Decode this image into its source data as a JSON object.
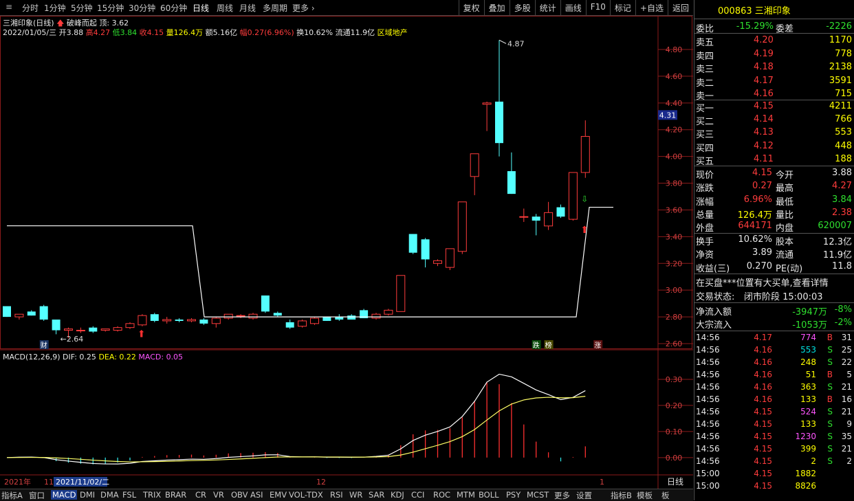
{
  "toolbar": {
    "left_items": [
      "分时",
      "1分钟",
      "5分钟",
      "15分钟",
      "30分钟",
      "60分钟",
      "日线",
      "周线",
      "月线",
      "多周期",
      "更多"
    ],
    "active": "日线",
    "right_items": [
      "复权",
      "叠加",
      "多股",
      "统计",
      "画线",
      "F10",
      "标记",
      "+自选",
      "返回"
    ]
  },
  "chart_header": {
    "title": "三湘印象(日线)",
    "indicator_name": "破峰而起",
    "indicator_value": "顶: 3.62",
    "date_line": "2022/01/05/三",
    "open": "开3.88",
    "high": "高4.27",
    "low": "低3.84",
    "close": "收4.15",
    "volume": "量126.4万",
    "amount": "额5.16亿",
    "change": "幅0.27(6.96%)",
    "turnover": "换10.62%",
    "float": "流通11.9亿",
    "sector": "区域地产"
  },
  "price_axis": [
    "4.80",
    "4.60",
    "4.40",
    "4.20",
    "4.00",
    "3.80",
    "3.60",
    "3.40",
    "3.20",
    "3.00",
    "2.80",
    "2.60"
  ],
  "current_price_tag": "4.31",
  "annotations": {
    "high": "4.87",
    "low": "2.64"
  },
  "markers": {
    "cai": "财",
    "die": "跌",
    "bang": "榜",
    "zhang": "涨"
  },
  "macd_header": {
    "name": "MACD(12,26,9)",
    "dif": "DIF: 0.25",
    "dea": "DEA: 0.22",
    "macd": "MACD: 0.05"
  },
  "macd_axis": [
    "0.30",
    "0.20",
    "0.10",
    "0.00"
  ],
  "time_axis": {
    "year": "2021年",
    "m11": "11",
    "selected_date": "2021/11/02/二",
    "m12": "12",
    "m1": "1"
  },
  "period_label": "日线",
  "chart_data": {
    "type": "candlestick",
    "title": "三湘印象(日线)",
    "price_range": [
      2.55,
      4.95
    ],
    "candles": [
      {
        "o": 2.88,
        "h": 2.88,
        "l": 2.8,
        "c": 2.8
      },
      {
        "o": 2.8,
        "h": 2.82,
        "l": 2.78,
        "c": 2.82
      },
      {
        "o": 2.84,
        "h": 2.85,
        "l": 2.81,
        "c": 2.81
      },
      {
        "o": 2.88,
        "h": 2.89,
        "l": 2.77,
        "c": 2.78
      },
      {
        "o": 2.78,
        "h": 2.78,
        "l": 2.67,
        "c": 2.7
      },
      {
        "o": 2.7,
        "h": 2.72,
        "l": 2.64,
        "c": 2.71
      },
      {
        "o": 2.7,
        "h": 2.72,
        "l": 2.68,
        "c": 2.7
      },
      {
        "o": 2.72,
        "h": 2.73,
        "l": 2.68,
        "c": 2.69
      },
      {
        "o": 2.7,
        "h": 2.71,
        "l": 2.69,
        "c": 2.71
      },
      {
        "o": 2.7,
        "h": 2.73,
        "l": 2.69,
        "c": 2.72
      },
      {
        "o": 2.72,
        "h": 2.76,
        "l": 2.71,
        "c": 2.75
      },
      {
        "o": 2.74,
        "h": 2.82,
        "l": 2.73,
        "c": 2.81
      },
      {
        "o": 2.82,
        "h": 2.83,
        "l": 2.76,
        "c": 2.77
      },
      {
        "o": 2.77,
        "h": 2.8,
        "l": 2.75,
        "c": 2.78
      },
      {
        "o": 2.78,
        "h": 2.79,
        "l": 2.76,
        "c": 2.77
      },
      {
        "o": 2.77,
        "h": 2.79,
        "l": 2.76,
        "c": 2.78
      },
      {
        "o": 2.78,
        "h": 2.79,
        "l": 2.74,
        "c": 2.75
      },
      {
        "o": 2.75,
        "h": 2.8,
        "l": 2.72,
        "c": 2.79
      },
      {
        "o": 2.79,
        "h": 2.82,
        "l": 2.78,
        "c": 2.82
      },
      {
        "o": 2.81,
        "h": 2.82,
        "l": 2.79,
        "c": 2.81
      },
      {
        "o": 2.79,
        "h": 2.83,
        "l": 2.78,
        "c": 2.82
      },
      {
        "o": 2.96,
        "h": 2.96,
        "l": 2.83,
        "c": 2.84
      },
      {
        "o": 2.83,
        "h": 2.84,
        "l": 2.8,
        "c": 2.81
      },
      {
        "o": 2.76,
        "h": 2.78,
        "l": 2.71,
        "c": 2.72
      },
      {
        "o": 2.73,
        "h": 2.78,
        "l": 2.72,
        "c": 2.77
      },
      {
        "o": 2.75,
        "h": 2.8,
        "l": 2.74,
        "c": 2.79
      },
      {
        "o": 2.8,
        "h": 2.8,
        "l": 2.77,
        "c": 2.77
      },
      {
        "o": 2.8,
        "h": 2.82,
        "l": 2.77,
        "c": 2.78
      },
      {
        "o": 2.81,
        "h": 2.82,
        "l": 2.78,
        "c": 2.78
      },
      {
        "o": 2.85,
        "h": 2.86,
        "l": 2.79,
        "c": 2.79
      },
      {
        "o": 2.79,
        "h": 2.83,
        "l": 2.78,
        "c": 2.82
      },
      {
        "o": 2.82,
        "h": 2.86,
        "l": 2.81,
        "c": 2.85
      },
      {
        "o": 2.84,
        "h": 3.11,
        "l": 2.84,
        "c": 3.11
      },
      {
        "o": 3.42,
        "h": 3.42,
        "l": 3.27,
        "c": 3.28
      },
      {
        "o": 3.38,
        "h": 3.39,
        "l": 3.17,
        "c": 3.23
      },
      {
        "o": 3.2,
        "h": 3.23,
        "l": 3.18,
        "c": 3.22
      },
      {
        "o": 3.17,
        "h": 3.31,
        "l": 3.15,
        "c": 3.31
      },
      {
        "o": 3.29,
        "h": 3.66,
        "l": 3.27,
        "c": 3.66
      },
      {
        "o": 3.85,
        "h": 4.02,
        "l": 3.71,
        "c": 4.02
      },
      {
        "o": 4.39,
        "h": 4.41,
        "l": 4.19,
        "c": 4.4
      },
      {
        "o": 4.41,
        "h": 4.87,
        "l": 4.0,
        "c": 4.1
      },
      {
        "o": 3.89,
        "h": 4.03,
        "l": 3.72,
        "c": 3.72
      },
      {
        "o": 3.55,
        "h": 3.61,
        "l": 3.51,
        "c": 3.55
      },
      {
        "o": 3.55,
        "h": 3.57,
        "l": 3.41,
        "c": 3.52
      },
      {
        "o": 3.48,
        "h": 3.66,
        "l": 3.45,
        "c": 3.58
      },
      {
        "o": 3.62,
        "h": 3.64,
        "l": 3.54,
        "c": 3.55
      },
      {
        "o": 3.53,
        "h": 3.88,
        "l": 3.52,
        "c": 3.88
      },
      {
        "o": 3.88,
        "h": 4.27,
        "l": 3.84,
        "c": 4.15
      }
    ],
    "indicator_line": {
      "name": "破峰而起",
      "top_value": 3.62
    },
    "macd": {
      "dif": 0.25,
      "dea": 0.22,
      "macd": 0.05,
      "range": [
        -0.04,
        0.35
      ]
    }
  },
  "panel": {
    "code": "000863",
    "name": "三湘印象",
    "weibi_label": "委比",
    "weibi": "-15.29%",
    "weicha_label": "委差",
    "weicha": "-2226",
    "asks": [
      {
        "label": "卖五",
        "price": "4.20",
        "vol": "1170"
      },
      {
        "label": "卖四",
        "price": "4.19",
        "vol": "778"
      },
      {
        "label": "卖三",
        "price": "4.18",
        "vol": "2138"
      },
      {
        "label": "卖二",
        "price": "4.17",
        "vol": "3591"
      },
      {
        "label": "卖一",
        "price": "4.16",
        "vol": "715"
      }
    ],
    "bids": [
      {
        "label": "买一",
        "price": "4.15",
        "vol": "4211"
      },
      {
        "label": "买二",
        "price": "4.14",
        "vol": "766"
      },
      {
        "label": "买三",
        "price": "4.13",
        "vol": "553"
      },
      {
        "label": "买四",
        "price": "4.12",
        "vol": "448"
      },
      {
        "label": "买五",
        "price": "4.11",
        "vol": "188"
      }
    ],
    "stats": [
      {
        "l1": "现价",
        "v1": "4.15",
        "c1": "red",
        "l2": "今开",
        "v2": "3.88",
        "c2": "white"
      },
      {
        "l1": "涨跌",
        "v1": "0.27",
        "c1": "red",
        "l2": "最高",
        "v2": "4.27",
        "c2": "red"
      },
      {
        "l1": "涨幅",
        "v1": "6.96%",
        "c1": "red",
        "l2": "最低",
        "v2": "3.84",
        "c2": "green"
      },
      {
        "l1": "总量",
        "v1": "126.4万",
        "c1": "yellow",
        "l2": "量比",
        "v2": "2.38",
        "c2": "red"
      },
      {
        "l1": "外盘",
        "v1": "644171",
        "c1": "red",
        "l2": "内盘",
        "v2": "620007",
        "c2": "green"
      }
    ],
    "stats2": [
      {
        "l1": "换手",
        "v1": "10.62%",
        "l2": "股本",
        "v2": "12.3亿"
      },
      {
        "l1": "净资",
        "v1": "3.89",
        "l2": "流通",
        "v2": "11.9亿"
      },
      {
        "l1": "收益(三)",
        "v1": "0.270",
        "l2": "PE(动)",
        "v2": "11.8"
      }
    ],
    "notice": "在买盘***位置有大买单,查看详情",
    "trade_status_label": "交易状态:",
    "trade_status": "闭市阶段 15:00:03",
    "net_inflow_label": "净流入额",
    "net_inflow": "-3947万",
    "net_inflow_pct": "-8%",
    "block_inflow_label": "大宗流入",
    "block_inflow": "-1053万",
    "block_inflow_pct": "-2%",
    "ticks": [
      {
        "t": "14:56",
        "p": "4.17",
        "v": "774",
        "s": "B",
        "n": "31",
        "pc": "red",
        "vc": "magenta"
      },
      {
        "t": "14:56",
        "p": "4.16",
        "v": "553",
        "s": "S",
        "n": "25",
        "pc": "red",
        "vc": "cyan"
      },
      {
        "t": "14:56",
        "p": "4.16",
        "v": "248",
        "s": "S",
        "n": "22",
        "pc": "red",
        "vc": "yellow"
      },
      {
        "t": "14:56",
        "p": "4.16",
        "v": "51",
        "s": "B",
        "n": "5",
        "pc": "red",
        "vc": "yellow"
      },
      {
        "t": "14:56",
        "p": "4.16",
        "v": "363",
        "s": "S",
        "n": "21",
        "pc": "red",
        "vc": "yellow"
      },
      {
        "t": "14:56",
        "p": "4.16",
        "v": "133",
        "s": "B",
        "n": "16",
        "pc": "red",
        "vc": "yellow"
      },
      {
        "t": "14:56",
        "p": "4.15",
        "v": "524",
        "s": "S",
        "n": "21",
        "pc": "red",
        "vc": "magenta"
      },
      {
        "t": "14:56",
        "p": "4.15",
        "v": "133",
        "s": "S",
        "n": "9",
        "pc": "red",
        "vc": "yellow"
      },
      {
        "t": "14:56",
        "p": "4.15",
        "v": "1230",
        "s": "S",
        "n": "35",
        "pc": "red",
        "vc": "magenta"
      },
      {
        "t": "14:56",
        "p": "4.15",
        "v": "399",
        "s": "S",
        "n": "21",
        "pc": "red",
        "vc": "yellow"
      },
      {
        "t": "14:56",
        "p": "4.15",
        "v": "2",
        "s": "S",
        "n": "2",
        "pc": "red",
        "vc": "yellow"
      },
      {
        "t": "15:00",
        "p": "4.15",
        "v": "1882",
        "s": "",
        "n": "",
        "pc": "red",
        "vc": "yellow"
      },
      {
        "t": "15:00",
        "p": "4.15",
        "v": "8826",
        "s": "",
        "n": "",
        "pc": "red",
        "vc": "yellow"
      }
    ]
  },
  "bottom_tabs": [
    "指标A",
    "窗口",
    "MACD",
    "DMI",
    "DMA",
    "FSL",
    "TRIX",
    "BRAR",
    "CR",
    "VR",
    "OBV",
    "ASI",
    "EMV",
    "VOL-TDX",
    "RSI",
    "WR",
    "SAR",
    "KDJ",
    "CCI",
    "ROC",
    "MTM",
    "BOLL",
    "PSY",
    "MCST",
    "更多",
    "设置",
    "指标B",
    "模板",
    "板"
  ],
  "bottom_active": "MACD",
  "colors": {
    "up": "#ff3c3c",
    "down": "#54ffff",
    "grid": "#8b1a1a",
    "ma": "#ffffff",
    "dea": "#ffff66"
  }
}
